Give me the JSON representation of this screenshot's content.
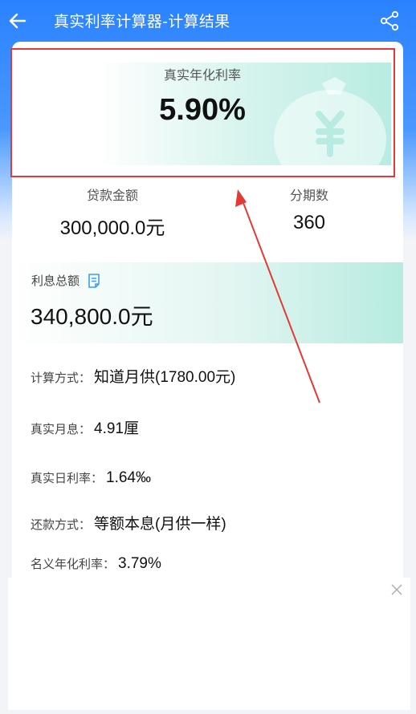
{
  "header": {
    "title": "真实利率计算器-计算结果",
    "back_icon": "arrow-left-icon",
    "share_icon": "share-icon"
  },
  "summary": {
    "real_annual_rate_label": "真实年化利率",
    "real_annual_rate_value": "5.90%",
    "loan_amount_label": "贷款金额",
    "loan_amount_value": "300,000.0元",
    "periods_label": "分期数",
    "periods_value": "360"
  },
  "interest": {
    "total_label": "利息总额",
    "total_value": "340,800.0元",
    "note_icon": "document-icon"
  },
  "details": [
    {
      "label": "计算方式：",
      "value": "知道月供(1780.00元)"
    },
    {
      "label": "真实月息：",
      "value": "4.91厘"
    },
    {
      "label": "真实日利率：",
      "value": "1.64‰"
    },
    {
      "label": "还款方式：",
      "value": "等额本息(月供一样)"
    },
    {
      "label": "名义年化利率：",
      "value": "3.79%"
    }
  ],
  "ad": {
    "close_icon": "close-icon"
  },
  "colors": {
    "header_blue": "#2a82ff",
    "teal_accent": "#b6ebe0",
    "annotation_red": "#e53935",
    "note_icon_blue": "#3aa0f0"
  }
}
